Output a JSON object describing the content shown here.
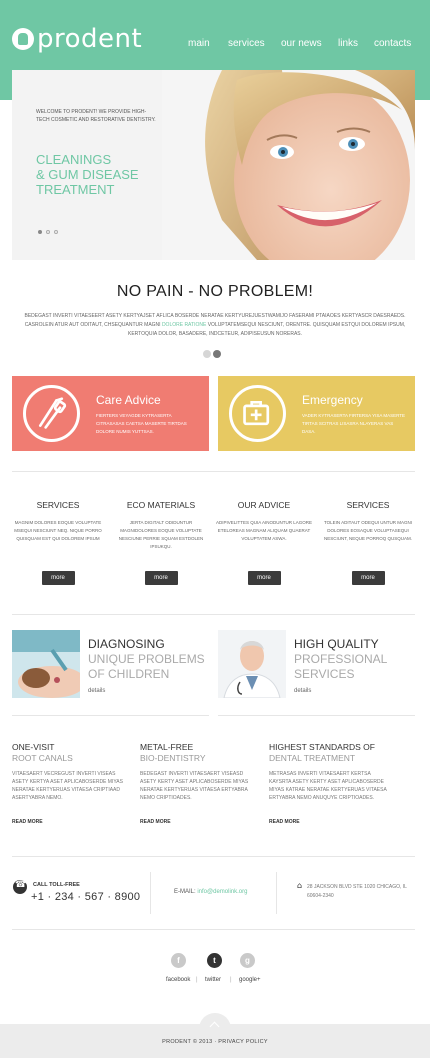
{
  "brand": {
    "logo_text": "prodent"
  },
  "nav": [
    "main",
    "services",
    "our news",
    "links",
    "contacts"
  ],
  "hero": {
    "kicker": "WELCOME TO PRODENT! WE PROVIDE HIGH-TECH COSMETIC AND RESTORATIVE DENTISTRY.",
    "title_line1": "CLEANINGS",
    "title_line2": "& GUM DISEASE",
    "title_line3": "TREATMENT"
  },
  "intro": {
    "title": "NO PAIN - NO PROBLEM!",
    "text_a": "BEDEGAST INVERTI VITAESEERT ASETY KERTYAJSET AFLICA BOSERDE NERATAE KERTYUREJUESTWAMIJO FASERAMI PTAIAOES KERTYASCR DAESRAEDS. CASROLEIN ATUR AUT ODITAUT, CHSEQUANTUR MAGNI",
    "text_highlight": "DOLORE RATIONE",
    "text_b": "VOLUPTATEMSEQUI NESCIUNT, ORENTRE. QUISQUAM ESTQUI DOLOREM IPSUM, KERTOQUIA DOLOR, BASADERE, INDCETEUR, ADIPISEUSUN NORERAS."
  },
  "boxes": [
    {
      "title": "Care Advice",
      "text": "FIERTERS VEYAGDE KYTRASERTA CITRASASAS CAETSA MASERTE TIRTDAS DOLORE NUMIS YUTTSAS."
    },
    {
      "title": "Emergency",
      "text": "VADER KYTRASERTA FIRTERSA YISA MASERTE TIRTAS SCITRAS LISASRA NLAYERAS VAS DASA."
    }
  ],
  "services": [
    {
      "title": "SERVICES",
      "text": "MAGNIM DOLORES EOQUE VOLUPTATE MSEQUI NESCIUNT NEQ. NIQUE PORRO QUISQUAM EST QUI DOLOREM IPSUM",
      "button": "more"
    },
    {
      "title": "ECO MATERIALS",
      "text": "JERTA DIGITALT ODIDUNTUR MAGNIDOLORES EOQUE VOLUPTATE NESCIUNE PERRIE SQUAM ESTDOLEN IPSUKQU.",
      "button": "more"
    },
    {
      "title": "OUR ADVICE",
      "text": "ADIPIVELITTES QUIA AINODUNTUR LAGORE ETELOREAS MAGNAM ALIQUAM QUAERAT VOLUPTATEM ASWA.",
      "button": "more"
    },
    {
      "title": "SERVICES",
      "text": "TOLEIN ADITAUT ODEQUI UNTUR MAGNI DOLORES EOSAQUE VOLUPTASEQUI NESCIUNT, NEQUE PORROQ QUSQUAM.",
      "button": "more"
    }
  ],
  "features": [
    {
      "line1": "DIAGNOSING",
      "line2": "UNIQUE PROBLEMS",
      "line3": "OF CHILDREN",
      "link": "details"
    },
    {
      "line1": "HIGH QUALITY",
      "line2": "PROFESSIONAL",
      "line3": "SERVICES",
      "link": "details"
    }
  ],
  "columns": [
    {
      "title_a": "ONE-VISIT",
      "title_b": "ROOT CANALS",
      "text": "Vitaesaert vecregust inverti viseas asety kertya aset aplicaboserde miyas neratae kertyeruas vitaesa criptiaad asertyabra nemo.",
      "link": "READ MORE"
    },
    {
      "title_a": "METAL-FREE",
      "title_b": "BIO-DENTISTRY",
      "text": "Bedegast inverti vitaesaert viseasd asety kerty aset aplicaboserde miyas neratae kertyeruas vitaesa ertyabra nemo criptioades.",
      "link": "READ MORE"
    },
    {
      "title_a": "HIGHEST STANDARDS OF",
      "title_b": "DENTAL TREATMENT",
      "text": "Metrasas inverti vitaesaert kertsa kaysrta asety kerty aset aplicaboserde miyas katrae neratae kertyeruas vitaesa ertyabra nemo anuquye criptioades.",
      "link": "READ MORE"
    }
  ],
  "contact": {
    "call_label": "CALL TOLL-FREE",
    "phone": "+1 · 234 · 567 · 8900",
    "email_label": "E-MAIL:",
    "email": "info@demolink.org",
    "address": "28 JACKSON BLVD STE 1020 CHICAGO, IL 60604-2340"
  },
  "social": {
    "facebook": "facebook",
    "twitter": "twitter",
    "google": "google+",
    "sep": "|"
  },
  "footer": {
    "text": "PRODENT © 2013 · PRIVACY POLICY"
  },
  "colors": {
    "brand": "#6fc7a4",
    "care": "#f07c72",
    "emergency": "#e7c962"
  },
  "icons": [
    "tooth-icon",
    "dental-tools-icon",
    "first-aid-icon",
    "phone-icon",
    "home-icon",
    "facebook-icon",
    "twitter-icon",
    "google-plus-icon",
    "scroll-top-icon"
  ]
}
